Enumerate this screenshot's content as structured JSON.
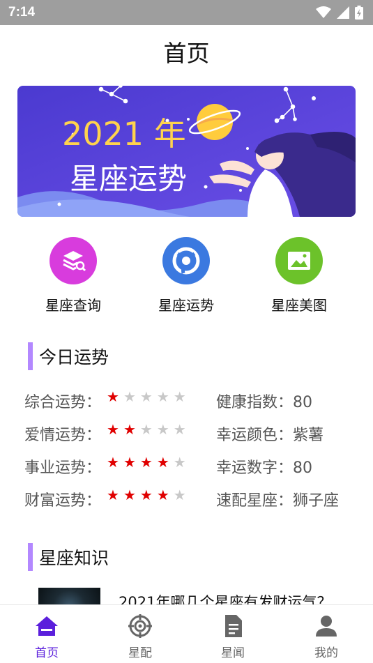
{
  "status_bar": {
    "time": "7:14"
  },
  "header": {
    "title": "首页"
  },
  "banner": {
    "line1": "2021 年",
    "line2": "星座运势"
  },
  "quick_nav": [
    {
      "label": "星座查询",
      "icon": "layers-search-icon",
      "color": "#d83cdd"
    },
    {
      "label": "星座运势",
      "icon": "swirl-icon",
      "color": "#3b79e0"
    },
    {
      "label": "星座美图",
      "icon": "image-icon",
      "color": "#6cc22a"
    }
  ],
  "today_fortune": {
    "title": "今日运势",
    "rows": [
      {
        "label": "综合运势：",
        "stars": 1,
        "max": 5,
        "right_label": "健康指数：",
        "right_value": "80"
      },
      {
        "label": "爱情运势：",
        "stars": 2,
        "max": 5,
        "right_label": "幸运颜色：",
        "right_value": "紫薯"
      },
      {
        "label": "事业运势：",
        "stars": 4,
        "max": 5,
        "right_label": "幸运数字：",
        "right_value": "80"
      },
      {
        "label": "财富运势：",
        "stars": 4,
        "max": 5,
        "right_label": "速配星座：",
        "right_value": "狮子座"
      }
    ]
  },
  "knowledge": {
    "title": "星座知识",
    "items": [
      {
        "title": "2021年哪几个星座有发财运气？"
      }
    ]
  },
  "tab_bar": [
    {
      "label": "首页",
      "icon": "home-icon",
      "active": true
    },
    {
      "label": "星配",
      "icon": "target-icon",
      "active": false
    },
    {
      "label": "星闻",
      "icon": "document-icon",
      "active": false
    },
    {
      "label": "我的",
      "icon": "person-icon",
      "active": false
    }
  ],
  "colors": {
    "accent": "#5b1fdc",
    "inactive": "#666666",
    "section_bar": "#b388ff",
    "star_on": "#e00000",
    "star_off": "#c8c8c8",
    "banner_bg": "#5a3fd0",
    "status_bar": "#9e9e9e"
  }
}
